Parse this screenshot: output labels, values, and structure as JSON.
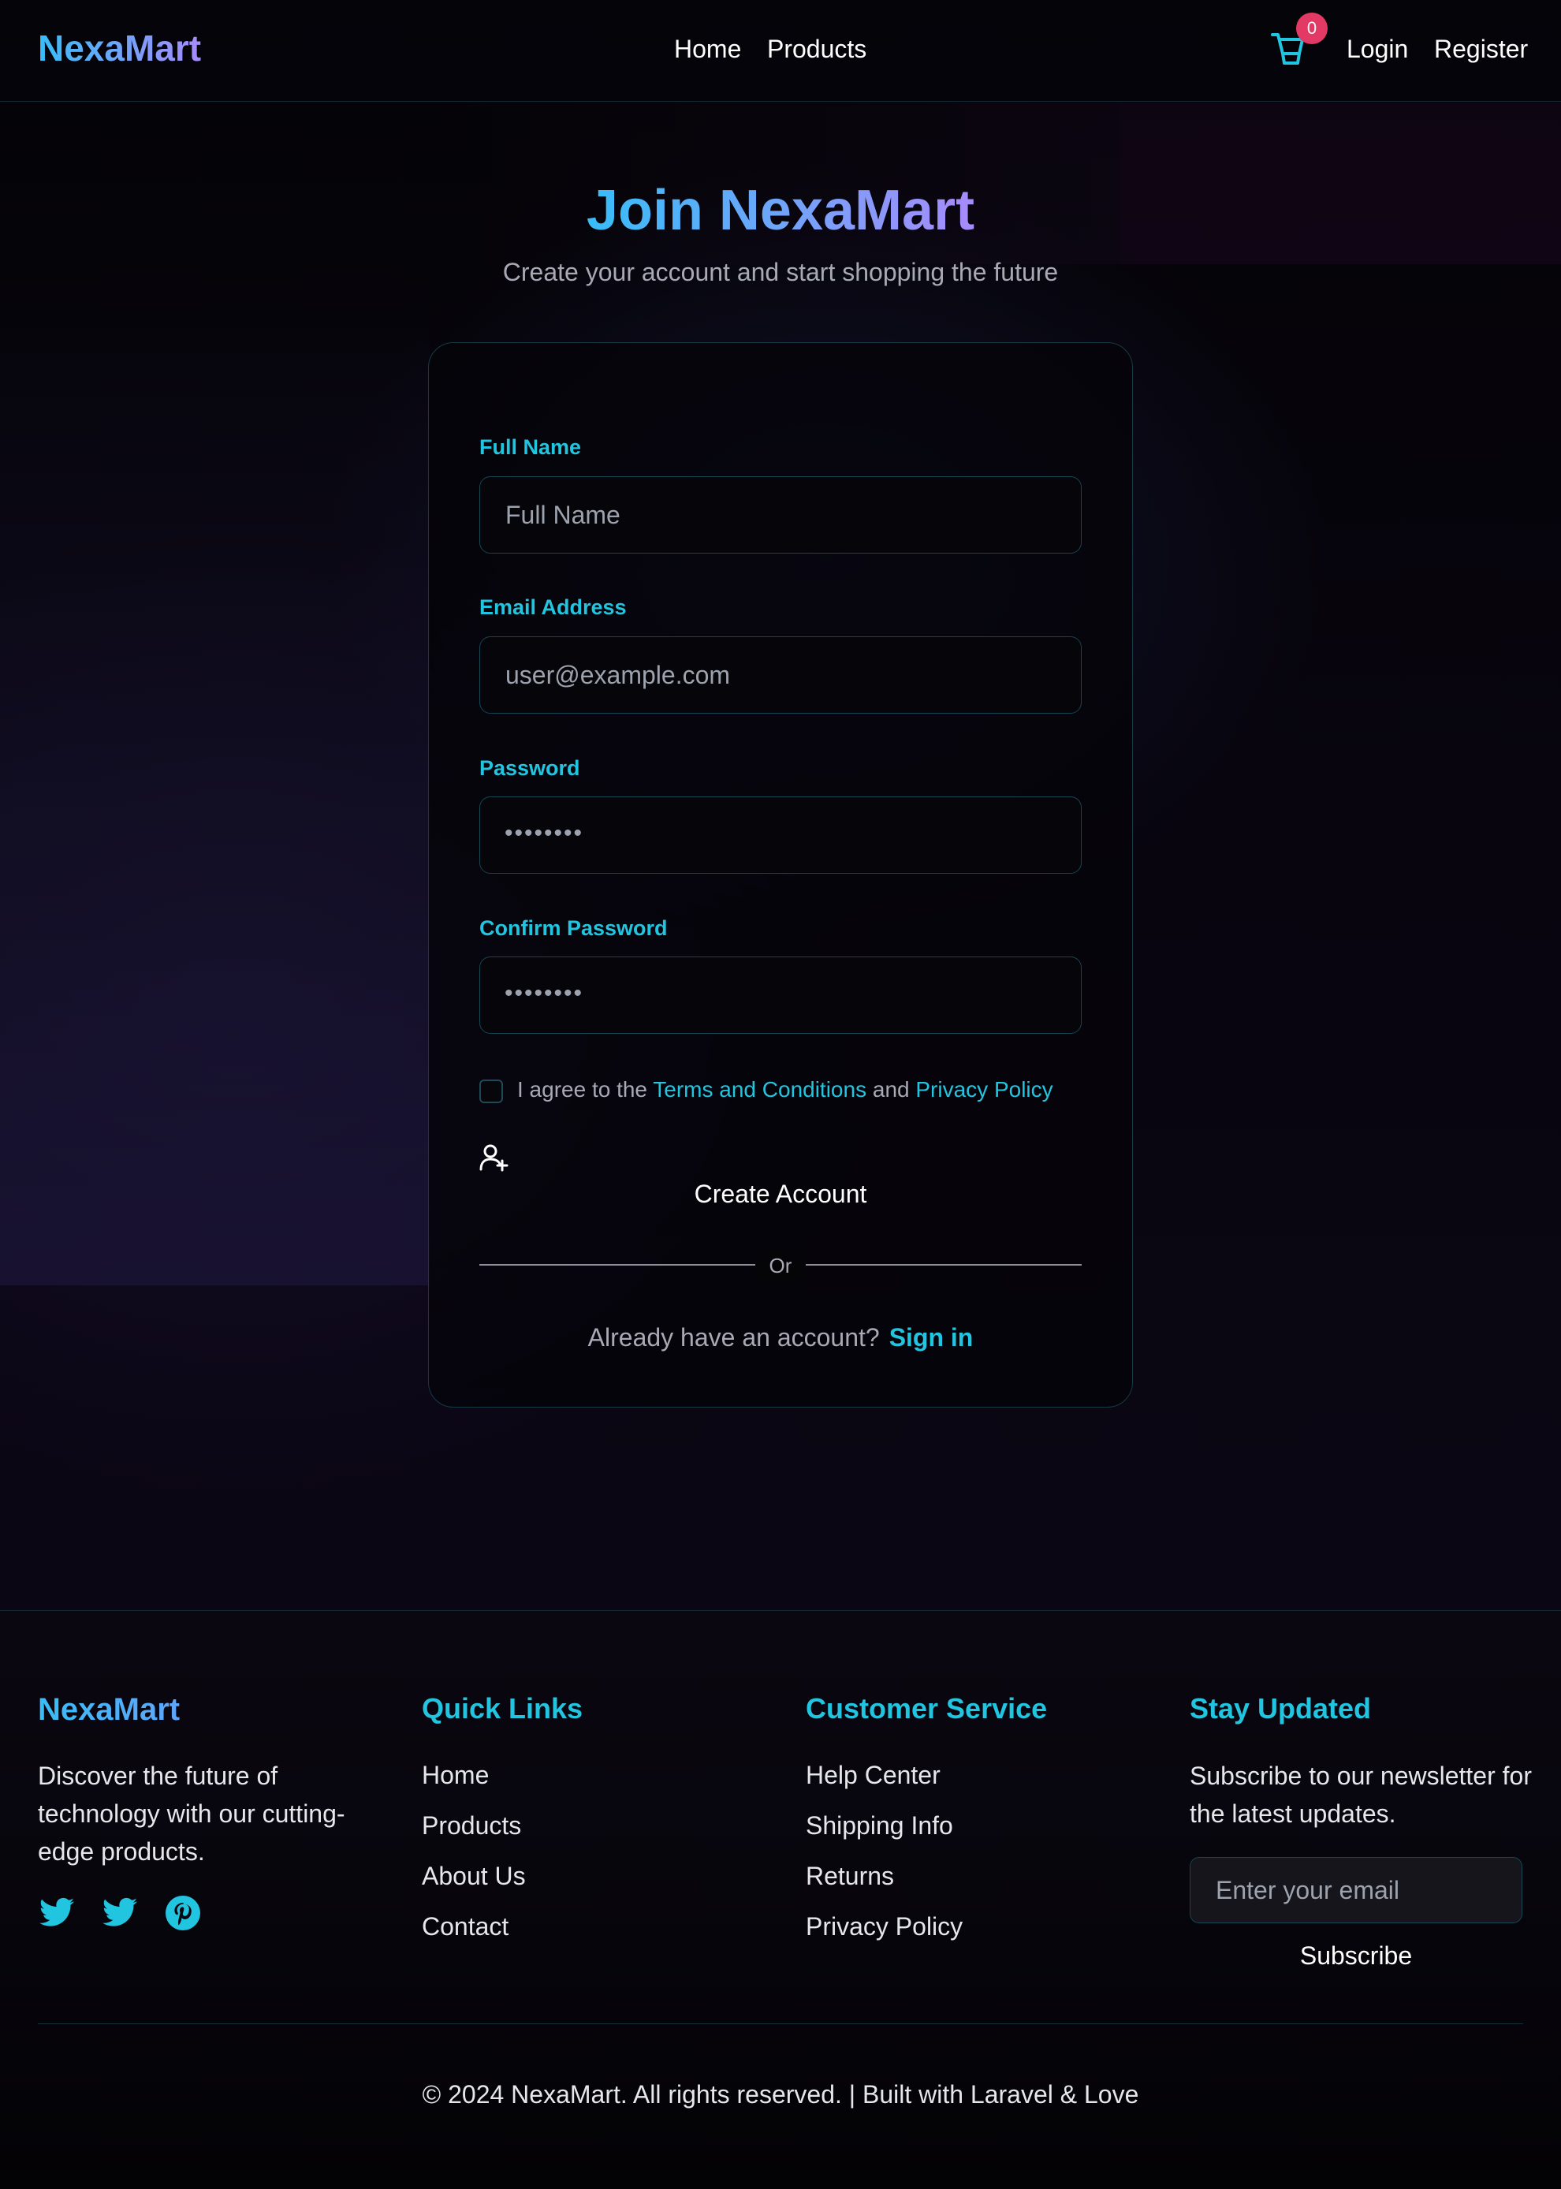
{
  "colors": {
    "accent": "#22c5e0",
    "brand_gradient_start": "#38bdf8",
    "brand_gradient_end": "#a78bfa",
    "badge": "#e23a64",
    "background": "#050308"
  },
  "header": {
    "brand": "NexaMart",
    "nav": [
      "Home",
      "Products"
    ],
    "cart_icon": "shopping-cart-icon",
    "cart_count": "0",
    "login": "Login",
    "register": "Register"
  },
  "hero": {
    "title": "Join NexaMart",
    "subtitle": "Create your account and start shopping the future"
  },
  "form": {
    "full_name": {
      "label": "Full Name",
      "placeholder": "Full Name"
    },
    "email": {
      "label": "Email Address",
      "placeholder": "user@example.com"
    },
    "password": {
      "label": "Password",
      "value": "••••••••"
    },
    "confirm_password": {
      "label": "Confirm Password",
      "value": "••••••••"
    },
    "terms": {
      "prefix": "I agree to the ",
      "terms_link": "Terms and Conditions",
      "middle": " and ",
      "privacy_link": "Privacy Policy"
    },
    "submit_icon": "user-plus-icon",
    "submit": "Create Account",
    "divider": "Or",
    "have_account": "Already have an account?",
    "sign_in": "Sign in"
  },
  "footer": {
    "brand": "NexaMart",
    "description": "Discover the future of technology with our cutting-edge products.",
    "social": [
      "twitter-icon",
      "twitter-icon",
      "pinterest-icon"
    ],
    "quick_links": {
      "title": "Quick Links",
      "items": [
        "Home",
        "Products",
        "About Us",
        "Contact"
      ]
    },
    "customer_service": {
      "title": "Customer Service",
      "items": [
        "Help Center",
        "Shipping Info",
        "Returns",
        "Privacy Policy"
      ]
    },
    "newsletter": {
      "title": "Stay Updated",
      "description": "Subscribe to our newsletter for the latest updates.",
      "placeholder": "Enter your email",
      "button": "Subscribe"
    },
    "copyright": "© 2024 NexaMart. All rights reserved. | Built with Laravel & Love"
  }
}
